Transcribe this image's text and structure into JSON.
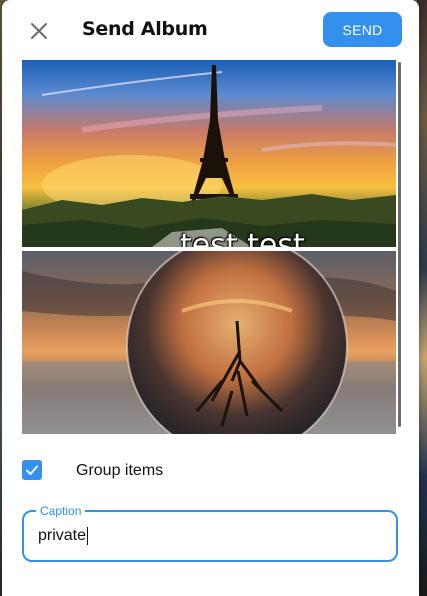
{
  "dialog": {
    "title": "Send Album",
    "send_label": "SEND",
    "accent": "#3390ec"
  },
  "album": {
    "photos": [
      {
        "subject": "Eiffel Tower at sunset",
        "overlay_text": "test  test"
      },
      {
        "subject": "Crystal ball reflecting tree at sunset"
      }
    ]
  },
  "group_items": {
    "label": "Group items",
    "checked": true
  },
  "caption": {
    "label": "Caption",
    "value": "private"
  },
  "icons": {
    "close": "close-icon",
    "check": "check-icon"
  }
}
